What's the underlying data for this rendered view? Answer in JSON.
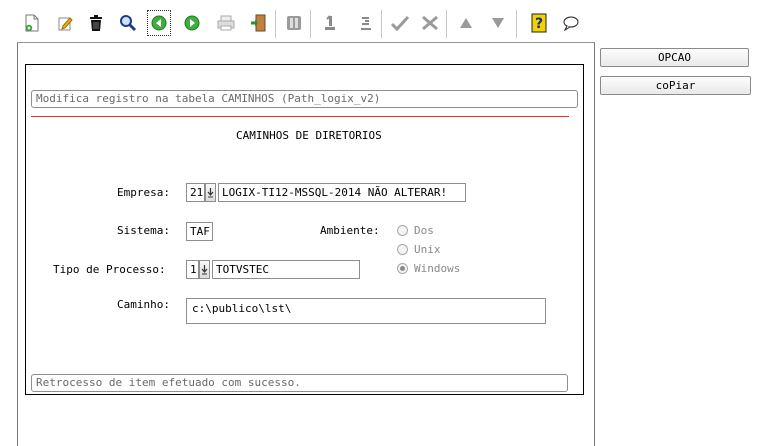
{
  "toolbar": {
    "icons": [
      "new-document-icon",
      "edit-pencil-icon",
      "delete-trash-icon",
      "search-magnifier-icon",
      "previous-record-icon",
      "next-record-icon",
      "print-icon",
      "exit-door-icon",
      "pages-icon",
      "first-page-icon",
      "last-page-icon",
      "confirm-check-icon",
      "cancel-cross-icon",
      "sort-up-icon",
      "sort-down-icon",
      "help-icon",
      "comment-bubble-icon"
    ]
  },
  "side_buttons": {
    "opcao": "OPCAO",
    "copiar": "coPiar"
  },
  "form": {
    "title_message": "Modifica registro na tabela CAMINHOS (Path_logix_v2)",
    "heading": "CAMINHOS DE DIRETORIOS",
    "empresa_label": "Empresa:",
    "empresa_code": "21",
    "empresa_name": "LOGIX-TI12-MSSQL-2014 NÃO ALTERAR!",
    "sistema_label": "Sistema:",
    "sistema_value": "TAF",
    "ambiente_label": "Ambiente:",
    "ambiente_options": [
      "Dos",
      "Unix",
      "Windows"
    ],
    "ambiente_selected": "Windows",
    "tipo_label": "Tipo de Processo:",
    "tipo_code": "1",
    "tipo_value": "TOTVSTEC",
    "caminho_label": "Caminho:",
    "caminho_value": "c:\\publico\\lst\\",
    "status_message": "Retrocesso de item efetuado com sucesso."
  },
  "colors": {
    "divider": "#dd3333",
    "help": "#f2d200"
  }
}
